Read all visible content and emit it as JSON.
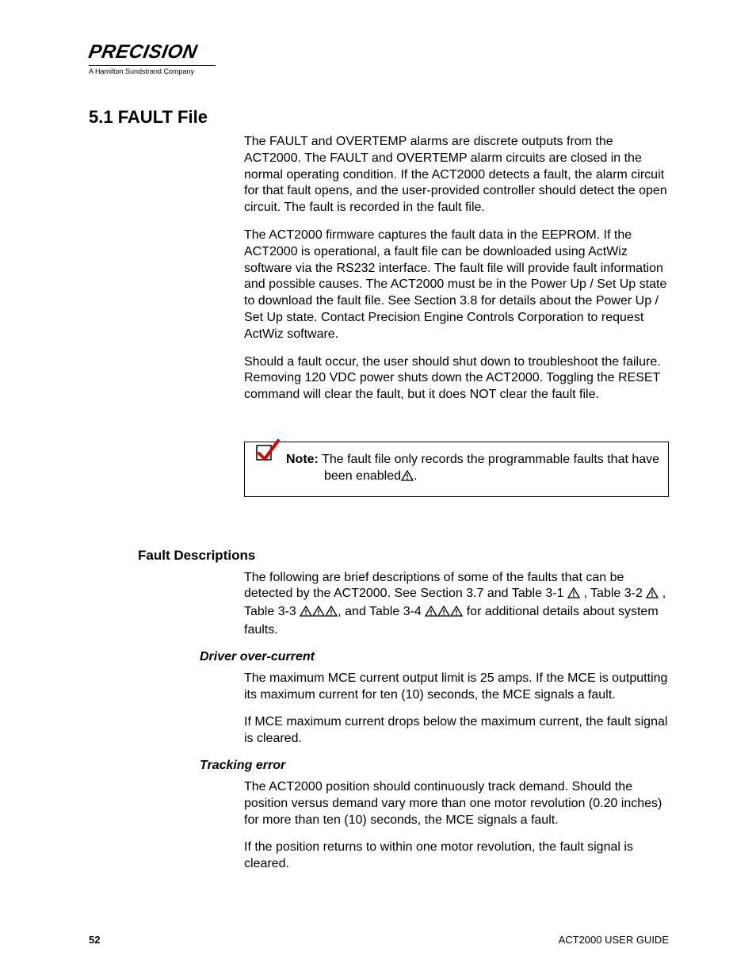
{
  "logo": {
    "brand": "PRECISION",
    "tagline": "A Hamilton Sundstrand Company"
  },
  "heading": "5.1  FAULT File",
  "paragraphs": {
    "p1": "The FAULT and OVERTEMP alarms are discrete outputs from the ACT2000. The FAULT and OVERTEMP alarm circuits are closed in the normal operating condition. If the ACT2000 detects a fault, the alarm circuit for that fault opens, and the user-provided controller should detect the open circuit. The fault is recorded in the fault file.",
    "p2": "The ACT2000 firmware captures the fault data in the EEPROM. If the ACT2000 is operational, a fault file can be downloaded using ActWiz software via the RS232 interface. The fault file will provide fault information and possible causes. The ACT2000 must be in the Power Up / Set Up state to download the fault file. See Section 3.8 for details about the Power Up / Set Up state. Contact Precision Engine Controls Corporation to request ActWiz software.",
    "p3": "Should a fault occur, the user should shut down to troubleshoot the failure. Removing 120 VDC power shuts down the ACT2000. Toggling the RESET command will clear the fault, but it does NOT clear the fault file."
  },
  "note": {
    "label": "Note:",
    "body_line1": " The fault file only records the programmable faults that have",
    "body_line2": "been enabled",
    "body_suffix": "."
  },
  "fault_descriptions": {
    "heading": "Fault Descriptions",
    "intro_parts": {
      "a": "The following are brief descriptions of some of the faults that can be detected by the ACT2000. See Section 3.7 and Table 3-1 ",
      "b": " , Table 3-2 ",
      "c": " , Table 3-3 ",
      "d": ", and Table 3-4 ",
      "e": " for additional details about system faults."
    },
    "driver_over_current": {
      "heading": "Driver over-current",
      "p1": "The maximum MCE current output limit is 25 amps. If the MCE is outputting its maximum current for ten (10) seconds, the MCE signals a fault.",
      "p2": "If MCE maximum current drops below the maximum current, the fault signal is cleared."
    },
    "tracking_error": {
      "heading": "Tracking error",
      "p1": "The ACT2000 position should continuously track demand. Should the position versus demand vary more than one motor revolution (0.20 inches) for more than ten (10) seconds, the MCE signals a fault.",
      "p2": "If the position returns to within one motor revolution, the fault signal is cleared."
    }
  },
  "footer": {
    "page_number": "52",
    "doc_title": "ACT2000 USER GUIDE"
  }
}
